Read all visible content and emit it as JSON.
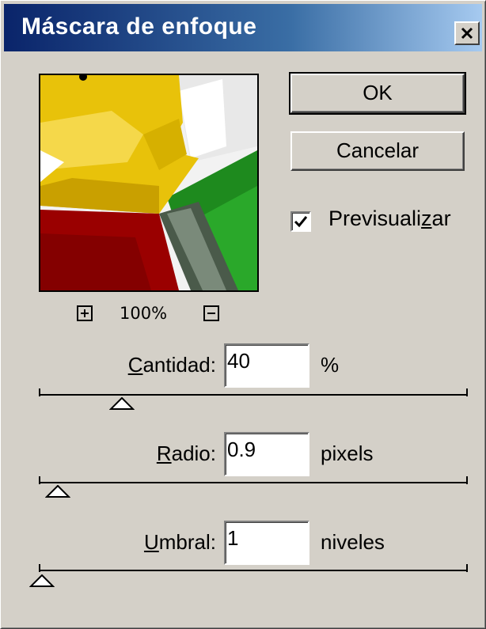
{
  "window": {
    "title": "Máscara de enfoque",
    "close_label": "X"
  },
  "preview": {
    "zoom_level": "100%"
  },
  "buttons": {
    "ok_label": "OK",
    "cancel_label": "Cancelar"
  },
  "preview_checkbox": {
    "label": "Previsualizar",
    "checked": true
  },
  "fields": [
    {
      "label": "Cantidad:",
      "value": "40",
      "unit": "%",
      "slider_fraction": 0.19
    },
    {
      "label": "Radio:",
      "value": "0.9",
      "unit": "pixels",
      "slider_fraction": 0.04
    },
    {
      "label": "Umbral:",
      "value": "1",
      "unit": "niveles",
      "slider_fraction": 0.0
    }
  ],
  "colors": {
    "dialog_bg": "#d4d0c8",
    "title_gradient_start": "#0a246a",
    "title_gradient_end": "#a6caf0",
    "preview_yellow": "#e8c20a",
    "preview_red": "#a00000",
    "preview_green": "#1e8a1e",
    "preview_white": "#f2f2f2"
  }
}
